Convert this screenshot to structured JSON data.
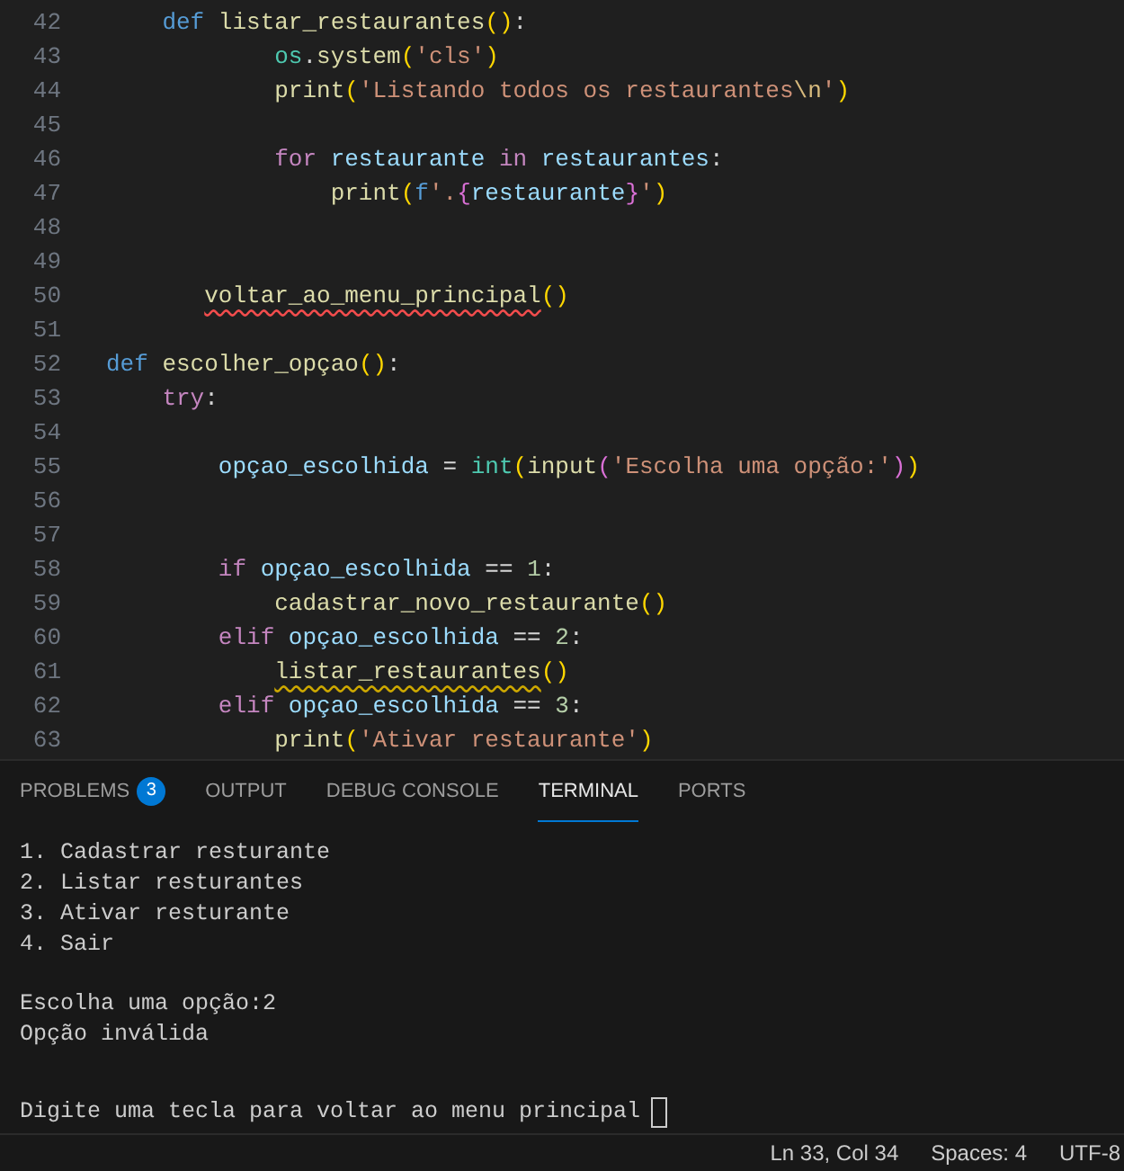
{
  "editor": {
    "lines": [
      {
        "number": "42",
        "tokens": [
          {
            "text": "    def",
            "kind": "keyword"
          },
          {
            "text": " listar_restaurantes",
            "kind": "function"
          },
          {
            "text": "()",
            "kind": "bracket1"
          },
          {
            "text": ":"
          }
        ]
      },
      {
        "number": "43",
        "tokens": [
          {
            "text": "            os",
            "kind": "type"
          },
          {
            "text": "."
          },
          {
            "text": "system",
            "kind": "function"
          },
          {
            "text": "(",
            "kind": "bracket1"
          },
          {
            "text": "'cls'",
            "kind": "string"
          },
          {
            "text": ")",
            "kind": "bracket1"
          }
        ]
      },
      {
        "number": "44",
        "tokens": [
          {
            "text": "            print",
            "kind": "function"
          },
          {
            "text": "(",
            "kind": "bracket1"
          },
          {
            "text": "'Listando todos os restaurantes",
            "kind": "string"
          },
          {
            "text": "\\n",
            "kind": "escape"
          },
          {
            "text": "'",
            "kind": "string"
          },
          {
            "text": ")",
            "kind": "bracket1"
          }
        ]
      },
      {
        "number": "45"
      },
      {
        "number": "46",
        "tokens": [
          {
            "text": "            for",
            "kind": "control"
          },
          {
            "text": " restaurante",
            "kind": "variable"
          },
          {
            "text": " in",
            "kind": "control"
          },
          {
            "text": " restaurantes",
            "kind": "variable"
          },
          {
            "text": ":"
          }
        ]
      },
      {
        "number": "47",
        "tokens": [
          {
            "text": "                print",
            "kind": "function"
          },
          {
            "text": "(",
            "kind": "bracket1"
          },
          {
            "text": "f",
            "kind": "keyword"
          },
          {
            "text": "'.",
            "kind": "string"
          },
          {
            "text": "{",
            "kind": "bracket2"
          },
          {
            "text": "restaurante",
            "kind": "variable"
          },
          {
            "text": "}",
            "kind": "bracket2"
          },
          {
            "text": "'",
            "kind": "string"
          },
          {
            "text": ")",
            "kind": "bracket1"
          }
        ]
      },
      {
        "number": "48"
      },
      {
        "number": "49"
      },
      {
        "number": "50",
        "tokens": [
          {
            "text": "       voltar_ao_menu_principal",
            "kind": "function",
            "error_underline": true
          },
          {
            "text": "()",
            "kind": "bracket1"
          }
        ]
      },
      {
        "number": "51"
      },
      {
        "number": "52",
        "tokens": [
          {
            "text": "def",
            "kind": "keyword"
          },
          {
            "text": " escolher_opçao",
            "kind": "function"
          },
          {
            "text": "()",
            "kind": "bracket1"
          },
          {
            "text": ":"
          }
        ]
      },
      {
        "number": "53",
        "tokens": [
          {
            "text": "    try",
            "kind": "control"
          },
          {
            "text": ":"
          }
        ]
      },
      {
        "number": "54"
      },
      {
        "number": "55",
        "tokens": [
          {
            "text": "        opçao_escolhida",
            "kind": "variable"
          },
          {
            "text": " = "
          },
          {
            "text": "int",
            "kind": "type"
          },
          {
            "text": "(",
            "kind": "bracket1"
          },
          {
            "text": "input",
            "kind": "function"
          },
          {
            "text": "(",
            "kind": "bracket2"
          },
          {
            "text": "'Escolha uma opção:'",
            "kind": "string"
          },
          {
            "text": ")",
            "kind": "bracket2"
          },
          {
            "text": ")",
            "kind": "bracket1"
          }
        ]
      },
      {
        "number": "56"
      },
      {
        "number": "57"
      },
      {
        "number": "58",
        "tokens": [
          {
            "text": "        if",
            "kind": "control"
          },
          {
            "text": " opçao_escolhida",
            "kind": "variable"
          },
          {
            "text": " == "
          },
          {
            "text": "1",
            "kind": "number"
          },
          {
            "text": ":"
          }
        ]
      },
      {
        "number": "59",
        "tokens": [
          {
            "text": "            cadastrar_novo_restaurante",
            "kind": "function"
          },
          {
            "text": "()",
            "kind": "bracket1"
          }
        ]
      },
      {
        "number": "60",
        "tokens": [
          {
            "text": "        elif",
            "kind": "control"
          },
          {
            "text": " opçao_escolhida",
            "kind": "variable"
          },
          {
            "text": " == "
          },
          {
            "text": "2",
            "kind": "number"
          },
          {
            "text": ":"
          }
        ]
      },
      {
        "number": "61",
        "tokens": [
          {
            "text": "            listar_restaurantes",
            "kind": "function",
            "warning_underline": true
          },
          {
            "text": "()",
            "kind": "bracket1"
          }
        ]
      },
      {
        "number": "62",
        "tokens": [
          {
            "text": "        elif",
            "kind": "control"
          },
          {
            "text": " opçao_escolhida",
            "kind": "variable"
          },
          {
            "text": " == "
          },
          {
            "text": "3",
            "kind": "number"
          },
          {
            "text": ":"
          }
        ]
      },
      {
        "number": "63",
        "tokens": [
          {
            "text": "            print",
            "kind": "function"
          },
          {
            "text": "(",
            "kind": "bracket1"
          },
          {
            "text": "'Ativar restaurante'",
            "kind": "string"
          },
          {
            "text": ")",
            "kind": "bracket1"
          }
        ]
      }
    ]
  },
  "panel": {
    "tabs": [
      {
        "label": "PROBLEMS",
        "badge": "3",
        "selected": false
      },
      {
        "label": "OUTPUT",
        "selected": false
      },
      {
        "label": "DEBUG CONSOLE",
        "selected": false
      },
      {
        "label": "TERMINAL",
        "selected": true
      },
      {
        "label": "PORTS",
        "selected": false
      }
    ],
    "terminal": {
      "groups": [
        {
          "lines": [
            "1. Cadastrar resturante",
            "2. Listar resturantes",
            "3. Ativar resturante",
            "4. Sair"
          ]
        },
        {
          "lines": [
            "Escolha uma opção:2",
            "Opção inválida"
          ]
        }
      ],
      "prompt": {
        "text": "Digite uma tecla para voltar ao menu principal",
        "cursor": true
      }
    }
  },
  "status_bar": {
    "items": [
      "Ln 33, Col 34",
      "Spaces: 4",
      "UTF-8"
    ]
  }
}
